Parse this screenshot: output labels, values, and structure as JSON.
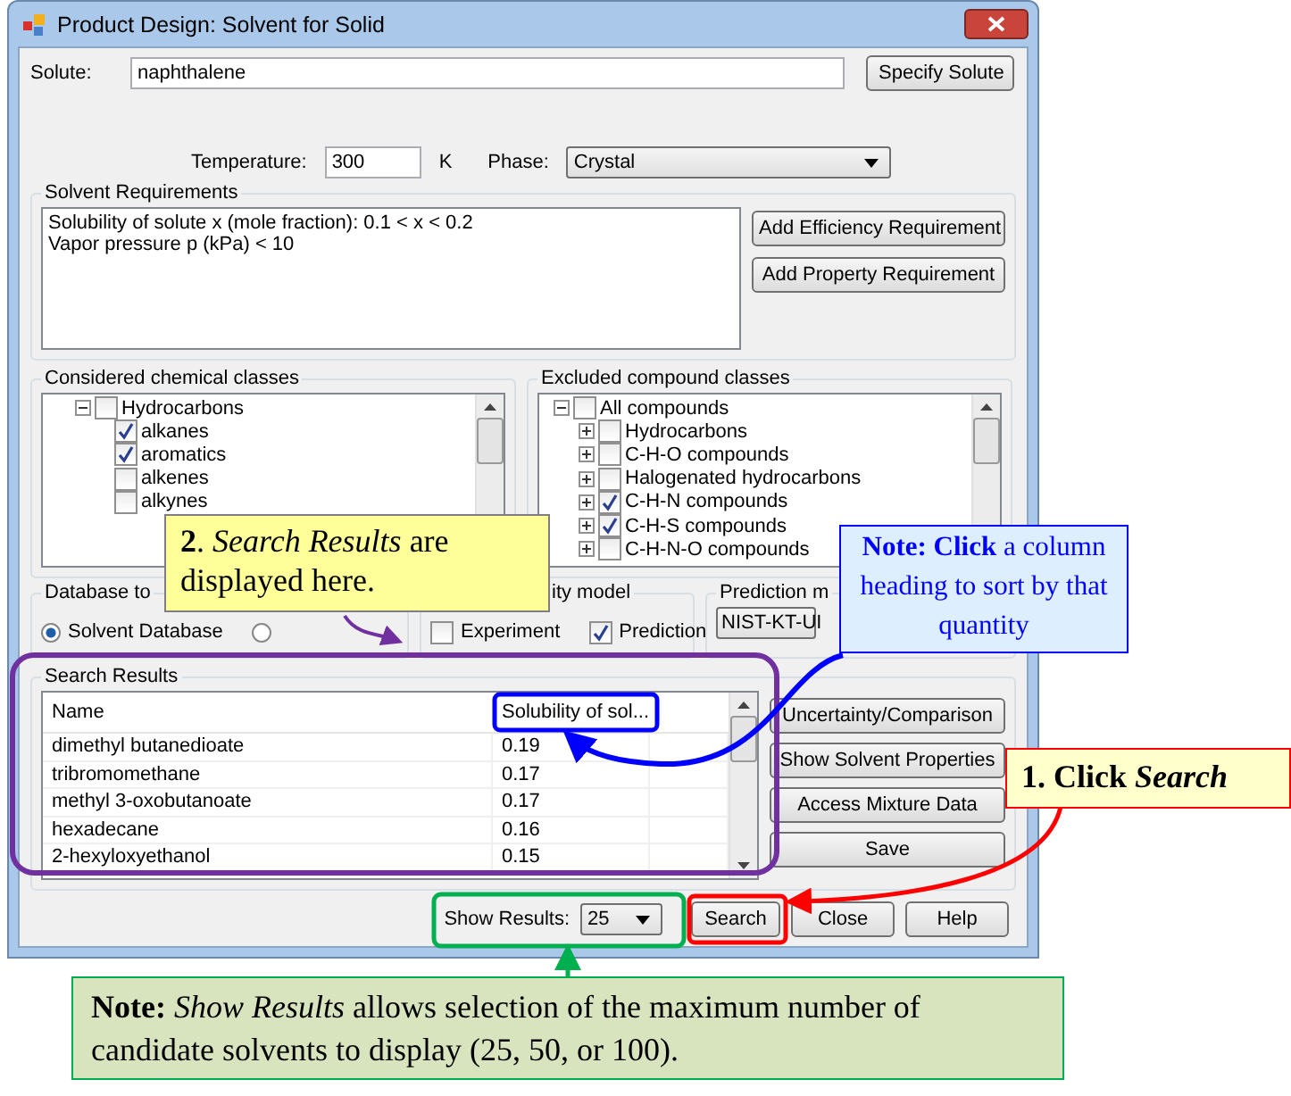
{
  "window": {
    "title": "Product Design: Solvent for Solid"
  },
  "solute": {
    "label": "Solute:",
    "value": "naphthalene",
    "button": "Specify Solute"
  },
  "conditions": {
    "temperature_label": "Temperature:",
    "temperature_value": "300",
    "temperature_unit": "K",
    "phase_label": "Phase:",
    "phase_value": "Crystal"
  },
  "solvent_requirements": {
    "title": "Solvent Requirements",
    "lines": [
      "Solubility of solute x (mole fraction): 0.1 < x < 0.2",
      "Vapor pressure p (kPa) < 10"
    ],
    "buttons": [
      "Add Efficiency Requirement",
      "Add Property Requirement"
    ]
  },
  "considered_classes": {
    "title": "Considered chemical classes",
    "items": [
      {
        "label": "Hydrocarbons",
        "checked": false,
        "expanded": true,
        "children": [
          {
            "label": "alkanes",
            "checked": true
          },
          {
            "label": "aromatics",
            "checked": true
          },
          {
            "label": "alkenes",
            "checked": false
          },
          {
            "label": "alkynes",
            "checked": false
          }
        ]
      }
    ]
  },
  "excluded_classes": {
    "title": "Excluded compound classes",
    "items": [
      {
        "label": "All compounds",
        "checked": false,
        "expanded": true,
        "children": [
          {
            "label": "Hydrocarbons",
            "checked": false,
            "expanded": false
          },
          {
            "label": "C-H-O compounds",
            "checked": false,
            "expanded": false
          },
          {
            "label": "Halogenated hydrocarbons",
            "checked": false,
            "expanded": false
          },
          {
            "label": "C-H-N compounds",
            "checked": true,
            "expanded": false
          },
          {
            "label": "C-H-S compounds",
            "checked": true,
            "expanded": false
          },
          {
            "label": "C-H-N-O compounds",
            "checked": false,
            "expanded": false
          }
        ]
      }
    ]
  },
  "database": {
    "title": "Database to",
    "options": [
      {
        "label": "Solvent Database",
        "selected": true
      },
      {
        "selected": false
      }
    ]
  },
  "solubility_model": {
    "title": "ity model",
    "options": [
      {
        "label": "Experiment",
        "checked": false
      },
      {
        "label": "Prediction",
        "checked": true
      }
    ]
  },
  "prediction_method": {
    "title": "Prediction m",
    "value": "NIST-KT-UI"
  },
  "search_results": {
    "title": "Search Results",
    "columns": [
      "Name",
      "Solubility of sol..."
    ],
    "rows": [
      [
        "dimethyl butanedioate",
        "0.19"
      ],
      [
        "tribromomethane",
        "0.17"
      ],
      [
        "methyl 3-oxobutanoate",
        "0.17"
      ],
      [
        "hexadecane",
        "0.16"
      ],
      [
        "2-hexyloxyethanol",
        "0.15"
      ]
    ],
    "buttons": [
      "Uncertainty/Comparison",
      "Show Solvent Properties",
      "Access Mixture Data",
      "Save"
    ]
  },
  "footer": {
    "show_results_label": "Show Results:",
    "show_results_value": "25",
    "buttons": [
      "Search",
      "Close",
      "Help"
    ]
  },
  "callouts": {
    "results": {
      "text": "**2**. *Search Results* are displayed here."
    },
    "sort": {
      "text": "**Note:** **Click** a column heading to sort by that quantity"
    },
    "search": {
      "text": "**1.** Click *Search*"
    },
    "show_results": {
      "text": "**Note:** *Show Results* allows selection of the maximum number of candidate solvents to display (25, 50, or 100)."
    }
  }
}
